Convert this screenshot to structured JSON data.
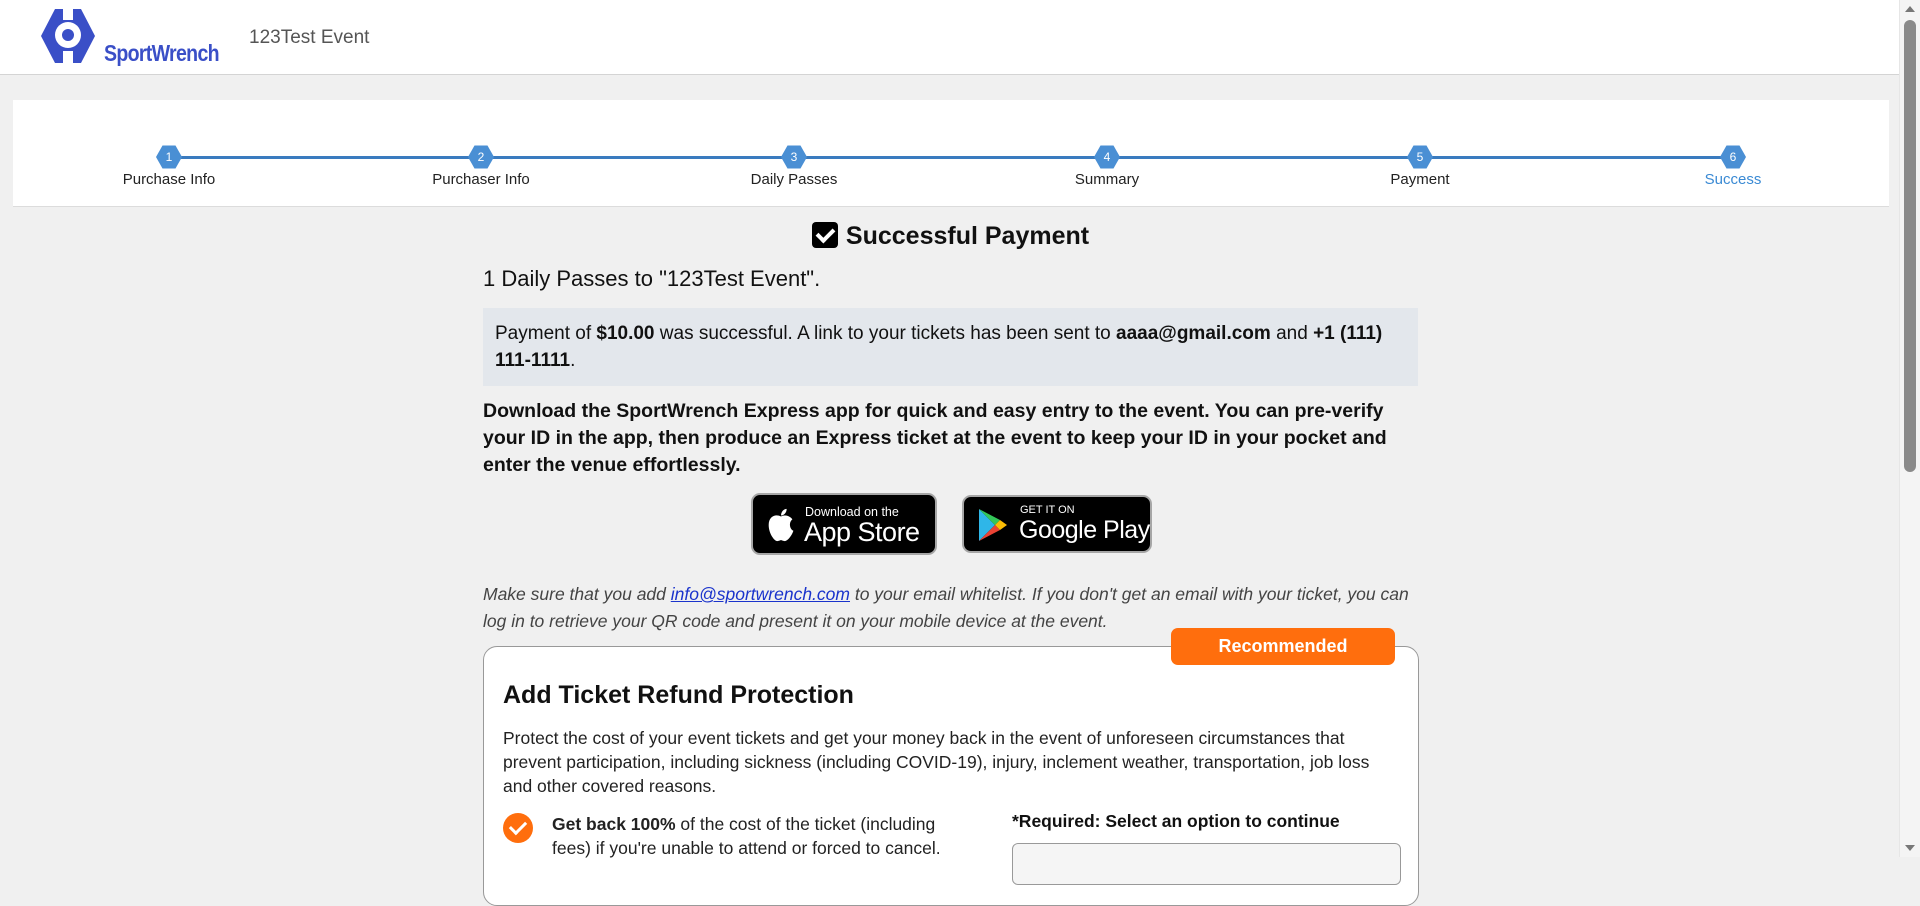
{
  "header": {
    "logo_text": "SportWrench",
    "event_title": "123Test Event"
  },
  "steps": [
    {
      "number": "1",
      "label": "Purchase Info",
      "state": "done"
    },
    {
      "number": "2",
      "label": "Purchaser Info",
      "state": "done"
    },
    {
      "number": "3",
      "label": "Daily Passes",
      "state": "done"
    },
    {
      "number": "4",
      "label": "Summary",
      "state": "done"
    },
    {
      "number": "5",
      "label": "Payment",
      "state": "done"
    },
    {
      "number": "6",
      "label": "Success",
      "state": "active"
    }
  ],
  "success": {
    "heading": "Successful Payment",
    "passes_line": "1 Daily Passes to \"123Test Event\".",
    "payment_prefix": "Payment of ",
    "amount": "$10.00",
    "payment_mid": " was successful. A link to your tickets has been sent to ",
    "email": "aaaa@gmail.com",
    "payment_and": " and ",
    "phone": "+1 (111) 111-1111",
    "payment_end": ".",
    "download_text": "Download the SportWrench Express app for quick and easy entry to the event. You can pre-verify your ID in the app, then produce an Express ticket at the event to keep your ID in your pocket and enter the venue effortlessly."
  },
  "app_badges": {
    "appstore_small": "Download on the",
    "appstore_big": "App Store",
    "googleplay_small": "GET IT ON",
    "googleplay_big": "Google Play"
  },
  "whitelist": {
    "prefix": "Make sure that you add ",
    "link": "info@sportwrench.com",
    "suffix": " to your email whitelist. If you don't get an email with your ticket, you can log in to retrieve your QR code and present it on your mobile device at the event."
  },
  "refund": {
    "badge": "Recommended",
    "title": "Add Ticket Refund Protection",
    "description": "Protect the cost of your event tickets and get your money back in the event of unforeseen circumstances that prevent participation, including sickness (including COVID-19), injury, inclement weather, transportation, job loss and other covered reasons.",
    "benefit_bold": "Get back 100%",
    "benefit_rest": " of the cost of the ticket (including fees) if you're unable to attend or forced to cancel.",
    "required": "*Required: Select an option to continue"
  },
  "colors": {
    "accent_blue": "#3a7bbf",
    "orange": "#ff6e0d",
    "logo_blue": "#3a4fc7"
  }
}
